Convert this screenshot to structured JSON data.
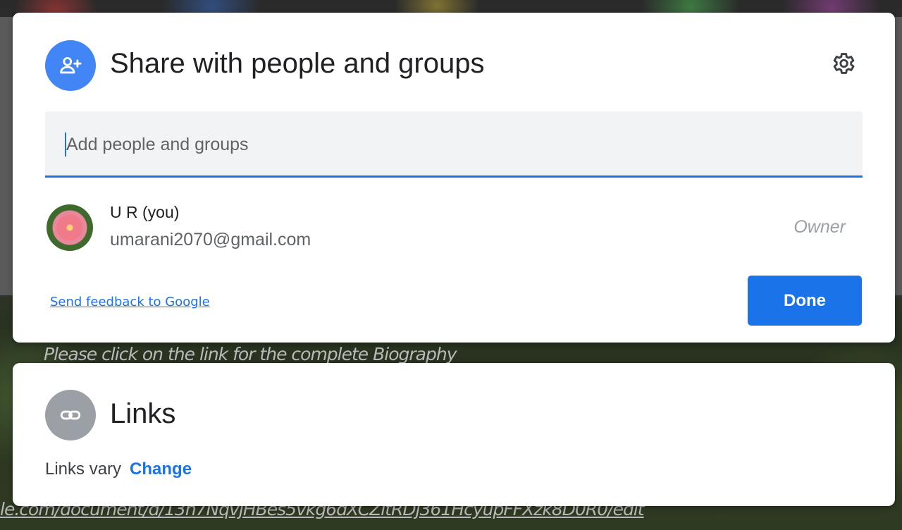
{
  "background": {
    "bio_text": "Please click on the link for the complete Biography",
    "url_text": "le.com/document/d/13h7NqvjHBes5vkg6dXCZltRDj361HcyupFFXzk8D0R0/edit"
  },
  "share": {
    "title": "Share with people and groups",
    "icon": "person-add-icon",
    "settings_icon": "gear-icon",
    "input": {
      "placeholder": "Add people and groups",
      "value": ""
    },
    "people": [
      {
        "name": "U R (you)",
        "email": "umarani2070@gmail.com",
        "role": "Owner"
      }
    ],
    "feedback_link": "Send feedback to Google",
    "done_label": "Done"
  },
  "links": {
    "title": "Links",
    "icon": "link-icon",
    "status": "Links vary",
    "change_label": "Change"
  },
  "colors": {
    "accent": "#1a73e8",
    "share_icon_bg": "#4285f4",
    "links_icon_bg": "#9aa0a6"
  }
}
